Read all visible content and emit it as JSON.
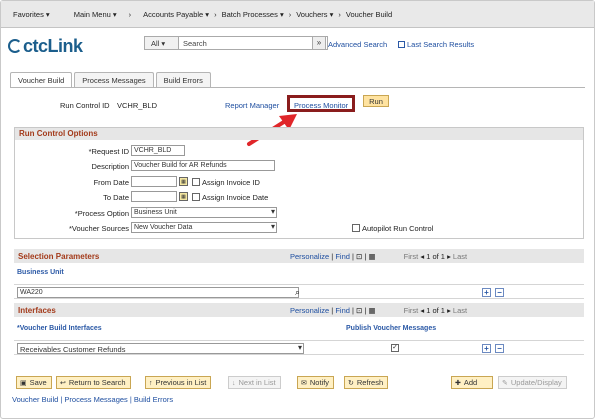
{
  "nav": {
    "favorites": "Favorites",
    "main_menu": "Main Menu",
    "bc1": "Accounts Payable",
    "bc2": "Batch Processes",
    "bc3": "Vouchers",
    "bc4": "Voucher Build"
  },
  "logo": {
    "text": "ctcLink"
  },
  "search": {
    "scope": "All",
    "placeholder": "Search",
    "advanced": "Advanced Search",
    "last": "Last Search Results"
  },
  "tabs": [
    "Voucher Build",
    "Process Messages",
    "Build Errors"
  ],
  "run": {
    "id_label": "Run Control ID",
    "id_value": "VCHR_BLD",
    "report_manager": "Report Manager",
    "process_monitor": "Process Monitor",
    "run_button": "Run"
  },
  "options": {
    "title": "Run Control Options",
    "request_id_label": "*Request ID",
    "request_id": "VCHR_BLD",
    "description_label": "Description",
    "description": "Voucher Build for AR Refunds",
    "from_date_label": "From Date",
    "to_date_label": "To Date",
    "assign_invoice_id": "Assign Invoice ID",
    "assign_invoice_date": "Assign Invoice Date",
    "process_option_label": "*Process Option",
    "process_option": "Business Unit",
    "voucher_sources_label": "*Voucher Sources",
    "voucher_sources": "New Voucher Data",
    "autopilot": "Autopilot Run Control"
  },
  "selection": {
    "title": "Selection Parameters",
    "personalize": "Personalize",
    "find": "Find",
    "first": "First",
    "count": "1 of 1",
    "last": "Last",
    "col": "Business Unit",
    "value": "WA220"
  },
  "interfaces": {
    "title": "Interfaces",
    "personalize": "Personalize",
    "find": "Find",
    "first": "First",
    "count": "1 of 1",
    "last": "Last",
    "col1": "*Voucher Build Interfaces",
    "col2": "Publish Voucher Messages",
    "value": "Receivables Customer Refunds"
  },
  "buttons": {
    "save": "Save",
    "return": "Return to Search",
    "previous": "Previous in List",
    "next": "Next in List",
    "notify": "Notify",
    "refresh": "Refresh",
    "add": "Add",
    "update": "Update/Display"
  },
  "footer": {
    "l1": "Voucher Build",
    "l2": "Process Messages",
    "l3": "Build Errors"
  },
  "colors": {
    "accent": "#a33a1a",
    "link": "#1f4fa0",
    "highlight": "#8a1d1d",
    "arrow": "#e0262a"
  }
}
